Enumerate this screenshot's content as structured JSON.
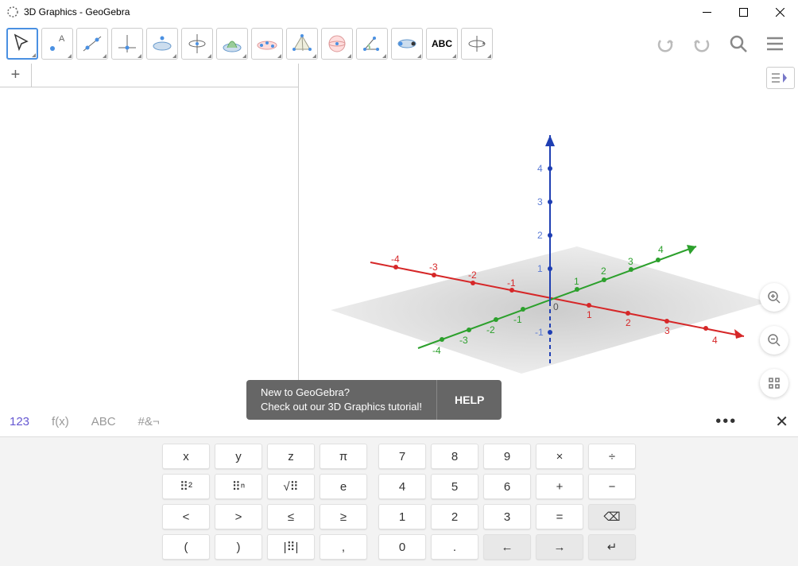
{
  "title": "3D Graphics - GeoGebra",
  "toolbar": {
    "tools": [
      {
        "name": "move-tool",
        "selected": true
      },
      {
        "name": "point-tool"
      },
      {
        "name": "line-tool"
      },
      {
        "name": "perp-tool"
      },
      {
        "name": "polygon-tool"
      },
      {
        "name": "circle-axis-tool"
      },
      {
        "name": "intersect-surface-tool"
      },
      {
        "name": "plane-tool"
      },
      {
        "name": "pyramid-tool"
      },
      {
        "name": "sphere-tool"
      },
      {
        "name": "angle-tool"
      },
      {
        "name": "reflect-tool"
      },
      {
        "name": "text-tool",
        "label": "ABC"
      },
      {
        "name": "rotate-view-tool"
      }
    ],
    "right": [
      "undo",
      "redo",
      "search",
      "menu"
    ]
  },
  "algebra": {
    "add_label": "+"
  },
  "graphics3d": {
    "axes": {
      "x": {
        "color": "#d62728",
        "ticks": [
          -4,
          -3,
          -2,
          -1,
          1,
          2,
          3,
          4
        ]
      },
      "y": {
        "color": "#2ca02c",
        "ticks": [
          -4,
          -3,
          -2,
          -1,
          1,
          2,
          3,
          4
        ]
      },
      "z": {
        "color": "#1f3fb3",
        "ticks": [
          -1,
          1,
          2,
          3,
          4
        ]
      }
    },
    "origin_label": "0"
  },
  "notification": {
    "line1": "New to GeoGebra?",
    "line2": "Check out our 3D Graphics tutorial!",
    "help": "HELP"
  },
  "keyboard": {
    "tabs": [
      "123",
      "f(x)",
      "ABC",
      "#&¬"
    ],
    "active_tab": 0,
    "left_keys": [
      "x",
      "y",
      "z",
      "π",
      "⠿²",
      "⠿ⁿ",
      "√⠿",
      "e",
      "<",
      ">",
      "≤",
      "≥",
      "(",
      ")",
      "|⠿|",
      ","
    ],
    "right_keys": [
      "7",
      "8",
      "9",
      "×",
      "÷",
      "4",
      "5",
      "6",
      "+",
      "−",
      "1",
      "2",
      "3",
      "=",
      "⌫",
      "0",
      ".",
      "←",
      "→",
      "↵"
    ]
  }
}
